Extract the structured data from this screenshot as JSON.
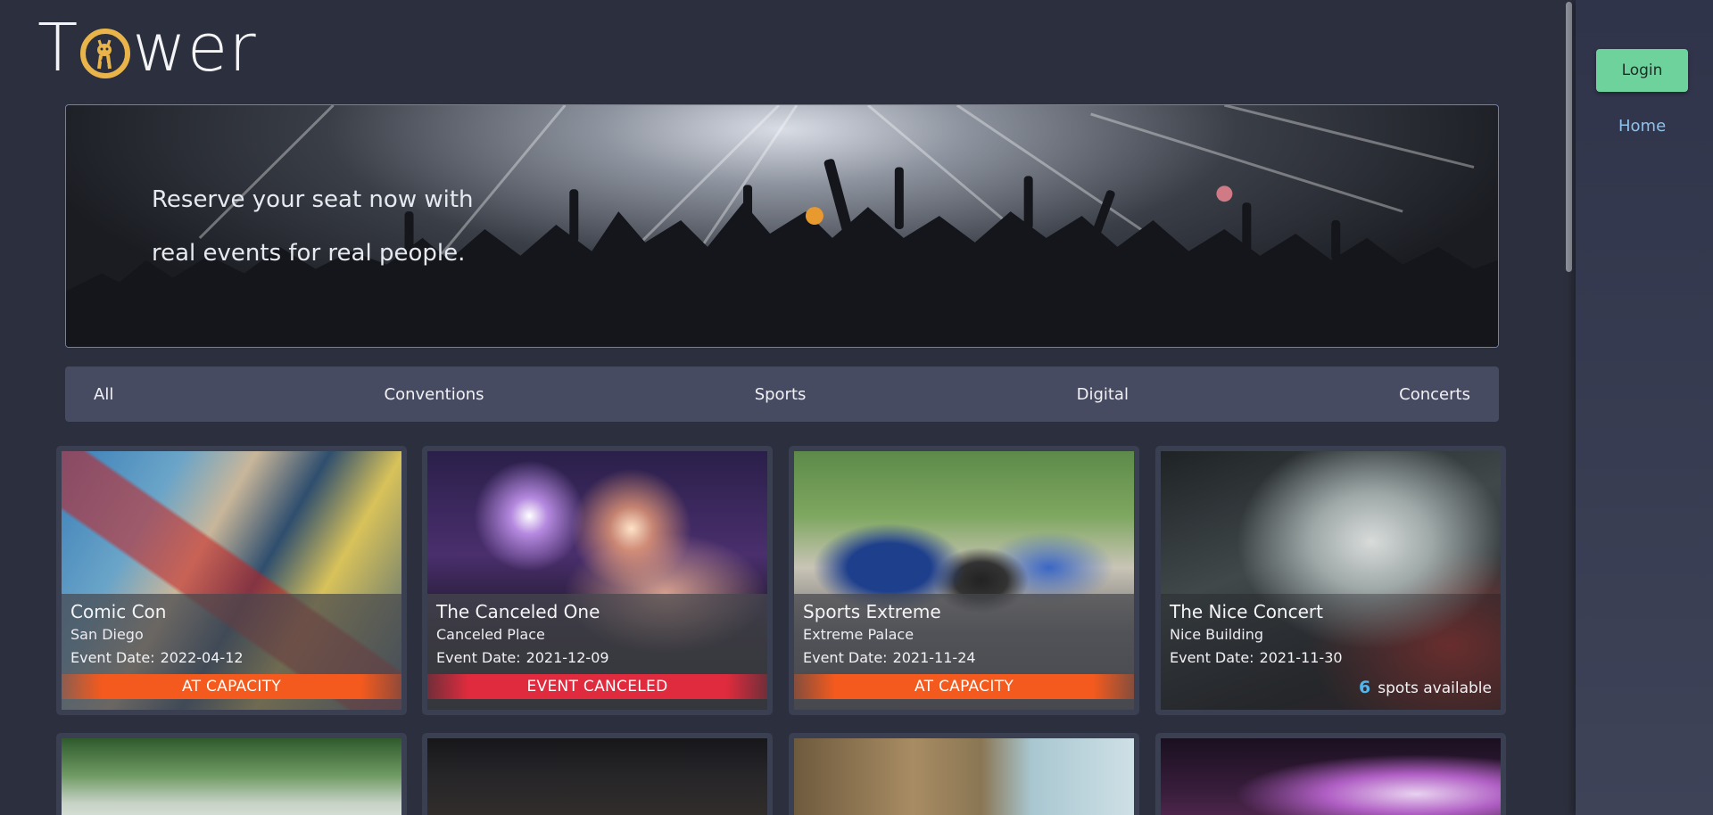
{
  "brand": {
    "name_start": "T",
    "name_end": "wer",
    "logo_icon": "giraffe-icon",
    "accent": "#e9b54a"
  },
  "hero": {
    "line1": "Reserve your seat now with",
    "line2": "real events for real people."
  },
  "filters": [
    "All",
    "Conventions",
    "Sports",
    "Digital",
    "Concerts"
  ],
  "events": [
    {
      "title": "Comic Con",
      "location": "San Diego",
      "date_label": "Event Date:",
      "date": "2022-04-12",
      "status": "AT CAPACITY"
    },
    {
      "title": "The Canceled One",
      "location": "Canceled Place",
      "date_label": "Event Date:",
      "date": "2021-12-09",
      "status": "EVENT CANCELED"
    },
    {
      "title": "Sports Extreme",
      "location": "Extreme Palace",
      "date_label": "Event Date:",
      "date": "2021-11-24",
      "status": "AT CAPACITY"
    },
    {
      "title": "The Nice Concert",
      "location": "Nice Building",
      "date_label": "Event Date:",
      "date": "2021-11-30",
      "spots": "6",
      "spots_label": "spots available"
    }
  ],
  "sidebar": {
    "login_label": "Login",
    "home_label": "Home"
  },
  "colors": {
    "background": "#2c2f3d",
    "capacity": "#f45a1d",
    "canceled": "#df2b3d",
    "login": "#6ed29d",
    "spots": "#4fb6f0",
    "home_link": "#8fc1ea"
  }
}
